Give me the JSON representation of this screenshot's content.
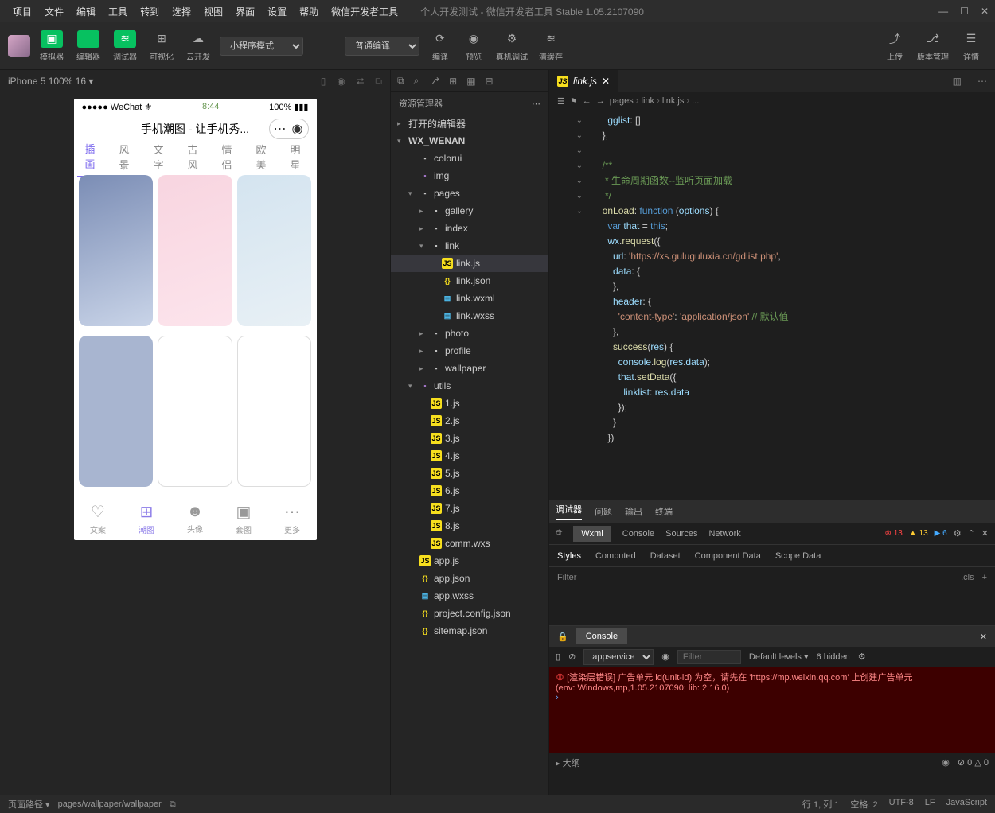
{
  "menus": [
    "项目",
    "文件",
    "编辑",
    "工具",
    "转到",
    "选择",
    "视图",
    "界面",
    "设置",
    "帮助",
    "微信开发者工具"
  ],
  "title_center": "个人开发测试 - 微信开发者工具 Stable 1.05.2107090",
  "toolbar": {
    "btns1": [
      {
        "l": "模拟器",
        "g": true,
        "ic": "▣"
      },
      {
        "l": "编辑器",
        "g": true,
        "ic": "</>"
      },
      {
        "l": "调试器",
        "g": true,
        "ic": "≋"
      },
      {
        "l": "可视化",
        "g": false,
        "ic": "⊞"
      },
      {
        "l": "云开发",
        "g": false,
        "ic": "☁"
      }
    ],
    "mode": "小程序模式",
    "compile": "普通编译",
    "btns2": [
      {
        "l": "编译",
        "ic": "⟳"
      },
      {
        "l": "预览",
        "ic": "◉"
      },
      {
        "l": "真机调试",
        "ic": "⚙"
      },
      {
        "l": "清缓存",
        "ic": "≋"
      }
    ],
    "btns3": [
      {
        "l": "上传",
        "ic": "⤴"
      },
      {
        "l": "版本管理",
        "ic": "⎇"
      },
      {
        "l": "详情",
        "ic": "☰"
      }
    ]
  },
  "devbar": "iPhone 5 100% 16 ▾",
  "sim": {
    "carrier": "●●●●● WeChat ⚜",
    "time": "8:44",
    "batt": "100% ▮▮▮",
    "title": "手机潮图 - 让手机秀...",
    "tabs": [
      "插画",
      "风景",
      "文字",
      "古风",
      "情侣",
      "欧美",
      "明星"
    ],
    "bottom": [
      [
        "♡",
        "文案"
      ],
      [
        "⊞",
        "潮图"
      ],
      [
        "☻",
        "头像"
      ],
      [
        "▣",
        "套图"
      ],
      [
        "⋯",
        "更多"
      ]
    ]
  },
  "explorer": {
    "title": "资源管理器",
    "nodes": [
      {
        "d": 0,
        "a": "▸",
        "t": "打开的编辑器",
        "c": "fo"
      },
      {
        "d": 0,
        "a": "▾",
        "t": "WX_WENAN",
        "c": "fo",
        "b": true
      },
      {
        "d": 1,
        "a": "",
        "t": "colorui",
        "c": "fo",
        "ic": "▪"
      },
      {
        "d": 1,
        "a": "",
        "t": "img",
        "c": "img",
        "ic": "▪"
      },
      {
        "d": 1,
        "a": "▾",
        "t": "pages",
        "c": "fo",
        "ic": "▪"
      },
      {
        "d": 2,
        "a": "▸",
        "t": "gallery",
        "c": "fo",
        "ic": "▪"
      },
      {
        "d": 2,
        "a": "▸",
        "t": "index",
        "c": "fo",
        "ic": "▪"
      },
      {
        "d": 2,
        "a": "▾",
        "t": "link",
        "c": "fo",
        "ic": "▪"
      },
      {
        "d": 3,
        "a": "",
        "t": "link.js",
        "c": "js",
        "ic": "JS",
        "sel": true
      },
      {
        "d": 3,
        "a": "",
        "t": "link.json",
        "c": "json",
        "ic": "{}"
      },
      {
        "d": 3,
        "a": "",
        "t": "link.wxml",
        "c": "wxml",
        "ic": "▤"
      },
      {
        "d": 3,
        "a": "",
        "t": "link.wxss",
        "c": "wxss",
        "ic": "▤"
      },
      {
        "d": 2,
        "a": "▸",
        "t": "photo",
        "c": "fo",
        "ic": "▪"
      },
      {
        "d": 2,
        "a": "▸",
        "t": "profile",
        "c": "fo",
        "ic": "▪"
      },
      {
        "d": 2,
        "a": "▸",
        "t": "wallpaper",
        "c": "fo",
        "ic": "▪"
      },
      {
        "d": 1,
        "a": "▾",
        "t": "utils",
        "c": "img",
        "ic": "▪"
      },
      {
        "d": 2,
        "a": "",
        "t": "1.js",
        "c": "js",
        "ic": "JS"
      },
      {
        "d": 2,
        "a": "",
        "t": "2.js",
        "c": "js",
        "ic": "JS"
      },
      {
        "d": 2,
        "a": "",
        "t": "3.js",
        "c": "js",
        "ic": "JS"
      },
      {
        "d": 2,
        "a": "",
        "t": "4.js",
        "c": "js",
        "ic": "JS"
      },
      {
        "d": 2,
        "a": "",
        "t": "5.js",
        "c": "js",
        "ic": "JS"
      },
      {
        "d": 2,
        "a": "",
        "t": "6.js",
        "c": "js",
        "ic": "JS"
      },
      {
        "d": 2,
        "a": "",
        "t": "7.js",
        "c": "js",
        "ic": "JS"
      },
      {
        "d": 2,
        "a": "",
        "t": "8.js",
        "c": "js",
        "ic": "JS"
      },
      {
        "d": 2,
        "a": "",
        "t": "comm.wxs",
        "c": "js",
        "ic": "JS"
      },
      {
        "d": 1,
        "a": "",
        "t": "app.js",
        "c": "js",
        "ic": "JS"
      },
      {
        "d": 1,
        "a": "",
        "t": "app.json",
        "c": "json",
        "ic": "{}"
      },
      {
        "d": 1,
        "a": "",
        "t": "app.wxss",
        "c": "wxss",
        "ic": "▤"
      },
      {
        "d": 1,
        "a": "",
        "t": "project.config.json",
        "c": "json",
        "ic": "{}"
      },
      {
        "d": 1,
        "a": "",
        "t": "sitemap.json",
        "c": "json",
        "ic": "{}"
      }
    ],
    "outline": "▸ 大纲"
  },
  "editor": {
    "tab": "link.js",
    "crumbs": [
      "pages",
      "link",
      "link.js",
      "..."
    ],
    "code": [
      "    <span class='v'>gglist</span>: []",
      "  },",
      "",
      "  <span class='c'>/**</span>",
      "<span class='c'>   * 生命周期函数--监听页面加载</span>",
      "<span class='c'>   */</span>",
      "  <span class='f'>onLoad</span>: <span class='k'>function</span> (<span class='v'>options</span>) {",
      "    <span class='k'>var</span> <span class='v'>that</span> = <span class='k'>this</span>;",
      "    <span class='v'>wx</span>.<span class='f'>request</span>({",
      "      <span class='v'>url</span>: <span class='s'>'https://xs.guluguluxia.cn/gdlist.php'</span>,",
      "      <span class='v'>data</span>: {",
      "      },",
      "      <span class='v'>header</span>: {",
      "        <span class='s'>'content-type'</span>: <span class='s'>'application/json'</span> <span class='c'>// 默认值</span>",
      "      },",
      "      <span class='f'>success</span>(<span class='v'>res</span>) {",
      "        <span class='v'>console</span>.<span class='f'>log</span>(<span class='v'>res</span>.<span class='v'>data</span>);",
      "        <span class='v'>that</span>.<span class='f'>setData</span>({",
      "          <span class='v'>linklist</span>: <span class='v'>res</span>.<span class='v'>data</span>",
      "        });",
      "      }",
      "    })"
    ]
  },
  "dbg": {
    "tabs": [
      "调试器",
      "问题",
      "输出",
      "终端"
    ],
    "panels": [
      "Wxml",
      "Console",
      "Sources",
      "Network"
    ],
    "badges": {
      "e": "13",
      "w": "13",
      "i": "6"
    },
    "styles": [
      "Styles",
      "Computed",
      "Dataset",
      "Component Data",
      "Scope Data"
    ],
    "filter": "Filter",
    "cls": ".cls"
  },
  "console": {
    "tab": "Console",
    "ctx": "appservice",
    "filter_ph": "Filter",
    "levels": "Default levels ▾",
    "hidden": "6 hidden",
    "msg1": "[渲染层错误] 广告单元 id(unit-id) 为空，请先在 'https://mp.weixin.qq.com' 上创建广告单元",
    "msg2": "(env: Windows,mp,1.05.2107090; lib: 2.16.0)"
  },
  "status": {
    "l1": "页面路径 ▾",
    "l2": "pages/wallpaper/wallpaper",
    "e": "0",
    "w": "0",
    "r": [
      "行 1, 列 1",
      "空格: 2",
      "UTF-8",
      "LF",
      "JavaScript"
    ]
  }
}
